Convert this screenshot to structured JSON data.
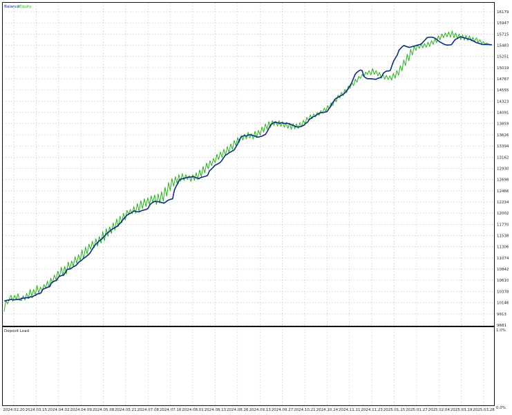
{
  "colors": {
    "balance": "#0a2a8a",
    "equity": "#22b316",
    "grid": "#c8c8c8",
    "frame": "#111111",
    "background": "#ffffff"
  },
  "chart_data": [
    {
      "type": "line",
      "legend": {
        "balance": "Balance",
        "separator": "/",
        "equity": "Equity"
      },
      "y_ticks": [
        "16179",
        "15947",
        "15715",
        "15483",
        "15251",
        "15019",
        "14787",
        "14555",
        "14323",
        "14091",
        "13859",
        "13626",
        "13394",
        "13162",
        "12930",
        "12698",
        "12466",
        "12234",
        "12002",
        "11770",
        "11538",
        "11306",
        "11074",
        "10842",
        "10610",
        "10378",
        "10146",
        "9913",
        "9681"
      ],
      "ylim": [
        9681,
        16179
      ],
      "x_ticks": [
        "2024.02.20",
        "2024.03.15",
        "2024.04.02",
        "2024.04.09",
        "2024.05.08",
        "2024.05.21",
        "2024.07.08",
        "2024.07.16",
        "2024.08.01",
        "2024.08.13",
        "2024.08.26",
        "2024.09.13",
        "2024.09.27",
        "2024.10.21",
        "2024.10.24",
        "2024.11.11",
        "2024.11.23",
        "2025.01.15",
        "2025.01.27",
        "2025.02.04",
        "2025.03.19",
        "2025.03.28"
      ],
      "series": [
        {
          "name": "Balance",
          "values": [
            10180,
            10185,
            10200,
            10200,
            10220,
            10200,
            10205,
            10210,
            10215,
            10210,
            10240,
            10240,
            10245,
            10250,
            10245,
            10270,
            10260,
            10290,
            10300,
            10330,
            10330,
            10350,
            10420,
            10440,
            10450,
            10470,
            10480,
            10560,
            10580,
            10600,
            10610,
            10680,
            10700,
            10710,
            10720,
            10780,
            10840,
            10840,
            10850,
            10880,
            10900,
            10920,
            10960,
            11000,
            11020,
            11060,
            11080,
            11110,
            11140,
            11180,
            11240,
            11300,
            11350,
            11380,
            11420,
            11450,
            11480,
            11520,
            11560,
            11600,
            11620,
            11660,
            11680,
            11700,
            11720,
            11750,
            11790,
            11830,
            11880,
            11920,
            11960,
            11980,
            12000,
            12020,
            12050,
            12040,
            12030,
            12030,
            12050,
            12060,
            12070,
            12080,
            12100,
            12170,
            12210,
            12230,
            12250,
            12240,
            12240,
            12230,
            12220,
            12210,
            12230,
            12260,
            12280,
            12290,
            12300,
            12480,
            12560,
            12620,
            12700,
            12710,
            12720,
            12730,
            12740,
            12750,
            12750,
            12755,
            12760,
            12740,
            12730,
            12720,
            12740,
            12750,
            12760,
            12770,
            12790,
            12880,
            12910,
            12950,
            12990,
            13010,
            13030,
            13050,
            13090,
            13150,
            13200,
            13220,
            13250,
            13270,
            13290,
            13310,
            13370,
            13430,
            13520,
            13580,
            13600,
            13610,
            13600,
            13620,
            13630,
            13620,
            13610,
            13600,
            13580,
            13580,
            13590,
            13600,
            13620,
            13640,
            13700,
            13770,
            13840,
            13860,
            13890,
            13880,
            13880,
            13860,
            13880,
            13870,
            13860,
            13870,
            13860,
            13850,
            13830,
            13820,
            13800,
            13790,
            13790,
            13800,
            13810,
            13830,
            13870,
            13890,
            13950,
            13970,
            14000,
            14010,
            14040,
            14060,
            14080,
            14090,
            14090,
            14100,
            14110,
            14160,
            14210,
            14280,
            14330,
            14380,
            14400,
            14420,
            14440,
            14460,
            14490,
            14530,
            14580,
            14640,
            14700,
            14790,
            14880,
            14920,
            14950,
            14970,
            14960,
            14840,
            14810,
            14790,
            14790,
            14790,
            14785,
            14780,
            14780,
            14800,
            14810,
            14820,
            14900,
            14930,
            14950,
            14950,
            14960,
            15060,
            15160,
            15220,
            15280,
            15380,
            15420,
            15460,
            15480,
            15460,
            15450,
            15440,
            15450,
            15460,
            15470,
            15480,
            15490,
            15500,
            15520,
            15560,
            15600,
            15640,
            15650,
            15650,
            15650,
            15640,
            15620,
            15590,
            15560,
            15540,
            15520,
            15500,
            15490,
            15490,
            15490,
            15500,
            15550,
            15600,
            15620,
            15640,
            15660,
            15650,
            15640,
            15630,
            15620,
            15610,
            15600,
            15580,
            15560,
            15540,
            15530,
            15520,
            15505,
            15500,
            15500,
            15500,
            15500,
            15495,
            15495
          ]
        },
        {
          "name": "Equity",
          "values": [
            9960,
            10200,
            10120,
            10230,
            10300,
            10180,
            10300,
            10210,
            10330,
            10200,
            10190,
            10290,
            10200,
            10340,
            10230,
            10420,
            10280,
            10420,
            10310,
            10500,
            10340,
            10470,
            10380,
            10520,
            10450,
            10590,
            10460,
            10650,
            10550,
            10720,
            10620,
            10800,
            10680,
            10880,
            10700,
            10900,
            10740,
            10990,
            10840,
            11010,
            10900,
            11100,
            10960,
            11140,
            11020,
            11240,
            11050,
            11300,
            11160,
            11360,
            11250,
            11420,
            11280,
            11470,
            11320,
            11520,
            11380,
            11620,
            11430,
            11680,
            11520,
            11720,
            11580,
            11800,
            11650,
            11880,
            11720,
            11940,
            11800,
            12000,
            11860,
            12060,
            11980,
            12080,
            11990,
            12140,
            12000,
            12200,
            12040,
            12260,
            12100,
            12300,
            12140,
            12320,
            12180,
            12360,
            12220,
            12380,
            12180,
            12400,
            12210,
            12450,
            12250,
            12540,
            12350,
            12640,
            12470,
            12720,
            12560,
            12760,
            12620,
            12800,
            12660,
            12820,
            12680,
            12800,
            12700,
            12780,
            12660,
            12800,
            12680,
            12840,
            12700,
            12900,
            12760,
            12970,
            12840,
            13040,
            12920,
            13090,
            12990,
            13140,
            13050,
            13220,
            13110,
            13270,
            13160,
            13330,
            13200,
            13380,
            13260,
            13440,
            13320,
            13510,
            13400,
            13570,
            13470,
            13610,
            13520,
            13640,
            13540,
            13680,
            13560,
            13650,
            13540,
            13700,
            13570,
            13720,
            13620,
            13790,
            13680,
            13850,
            13740,
            13900,
            13780,
            13920,
            13820,
            13910,
            13810,
            13920,
            13800,
            13900,
            13780,
            13880,
            13760,
            13870,
            13740,
            13860,
            13750,
            13850,
            13760,
            13880,
            13790,
            13930,
            13850,
            13990,
            13920,
            14040,
            13960,
            14060,
            14000,
            14090,
            14030,
            14130,
            14070,
            14180,
            14120,
            14230,
            14170,
            14290,
            14230,
            14370,
            14310,
            14450,
            14390,
            14510,
            14440,
            14570,
            14500,
            14640,
            14590,
            14710,
            14650,
            14780,
            14720,
            14840,
            14800,
            14880,
            14830,
            14930,
            14880,
            14960,
            14870,
            15000,
            14880,
            14960,
            14850,
            14920,
            14800,
            14880,
            14780,
            14860,
            14770,
            14850,
            14760,
            14900,
            14800,
            14960,
            14860,
            15060,
            14950,
            15180,
            15060,
            15300,
            15160,
            15400,
            15280,
            15460,
            15380,
            15500,
            15420,
            15520,
            15430,
            15520,
            15440,
            15550,
            15460,
            15580,
            15500,
            15620,
            15540,
            15680,
            15600,
            15720,
            15640,
            15740,
            15660,
            15760,
            15650,
            15780,
            15640,
            15740,
            15620,
            15720,
            15600,
            15700,
            15590,
            15690,
            15580,
            15680,
            15570,
            15650,
            15560,
            15640,
            15540,
            15600,
            15520,
            15560,
            15510,
            15530,
            15505,
            15500,
            15495
          ]
        }
      ]
    },
    {
      "type": "area",
      "title": "Deposit Load",
      "y_ticks": [
        "1.0%",
        "0.0%"
      ],
      "ylim": [
        0,
        1.0
      ],
      "values": []
    }
  ]
}
